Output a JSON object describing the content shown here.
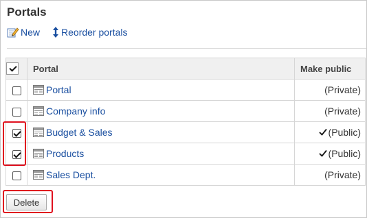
{
  "page": {
    "title": "Portals"
  },
  "toolbar": {
    "new_label": "New",
    "new_icon": "edit-pencil-icon",
    "reorder_label": "Reorder portals",
    "reorder_icon": "up-down-arrow-icon"
  },
  "table": {
    "header": {
      "select_all_checked": true,
      "portal": "Portal",
      "make_public": "Make public"
    },
    "rows": [
      {
        "name": "Portal",
        "checked": false,
        "public": false,
        "status": "(Private)"
      },
      {
        "name": "Company info",
        "checked": false,
        "public": false,
        "status": "(Private)"
      },
      {
        "name": "Budget & Sales",
        "checked": true,
        "public": true,
        "status": "(Public)"
      },
      {
        "name": "Products",
        "checked": true,
        "public": true,
        "status": "(Public)"
      },
      {
        "name": "Sales Dept.",
        "checked": false,
        "public": false,
        "status": "(Private)"
      }
    ]
  },
  "actions": {
    "delete_label": "Delete"
  },
  "colors": {
    "link": "#1a4fa0",
    "highlight": "#e0101e",
    "header_bg": "#f0f0f0"
  }
}
